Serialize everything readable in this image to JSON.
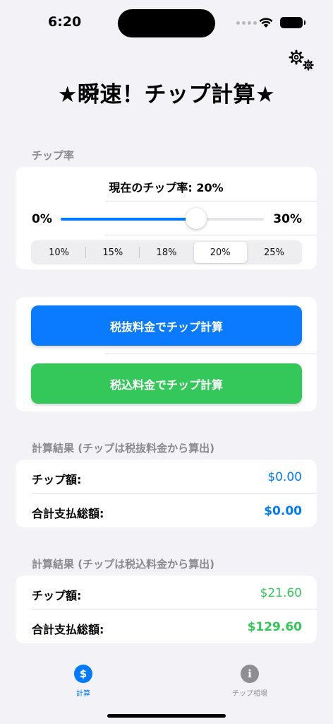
{
  "status": {
    "time": "6:20"
  },
  "title": "★瞬速！チップ計算★",
  "tip_section": {
    "label": "チップ率",
    "current_text": "現在のチップ率: 20%",
    "slider": {
      "min_label": "0%",
      "max_label": "30%",
      "value_percent": 20,
      "min": 0,
      "max": 30
    },
    "presets": [
      "10%",
      "15%",
      "18%",
      "20%",
      "25%"
    ],
    "selected_preset": "20%"
  },
  "actions": {
    "pre_tax_button": "税抜料金でチップ計算",
    "post_tax_button": "税込料金でチップ計算"
  },
  "result_pre_tax": {
    "label": "計算結果 (チップは税抜料金から算出)",
    "tip_label": "チップ額:",
    "tip_value": "$0.00",
    "total_label": "合計支払総額:",
    "total_value": "$0.00"
  },
  "result_post_tax": {
    "label": "計算結果 (チップは税込料金から算出)",
    "tip_label": "チップ額:",
    "tip_value": "$21.60",
    "total_label": "合計支払総額:",
    "total_value": "$129.60"
  },
  "tabs": [
    {
      "label": "計算",
      "icon": "dollar-icon",
      "glyph": "$",
      "active": true
    },
    {
      "label": "チップ相場",
      "icon": "info-icon",
      "glyph": "i",
      "active": false
    }
  ],
  "colors": {
    "accent": "#007aff",
    "green": "#34c759",
    "tab_inactive": "#8e8e93"
  }
}
